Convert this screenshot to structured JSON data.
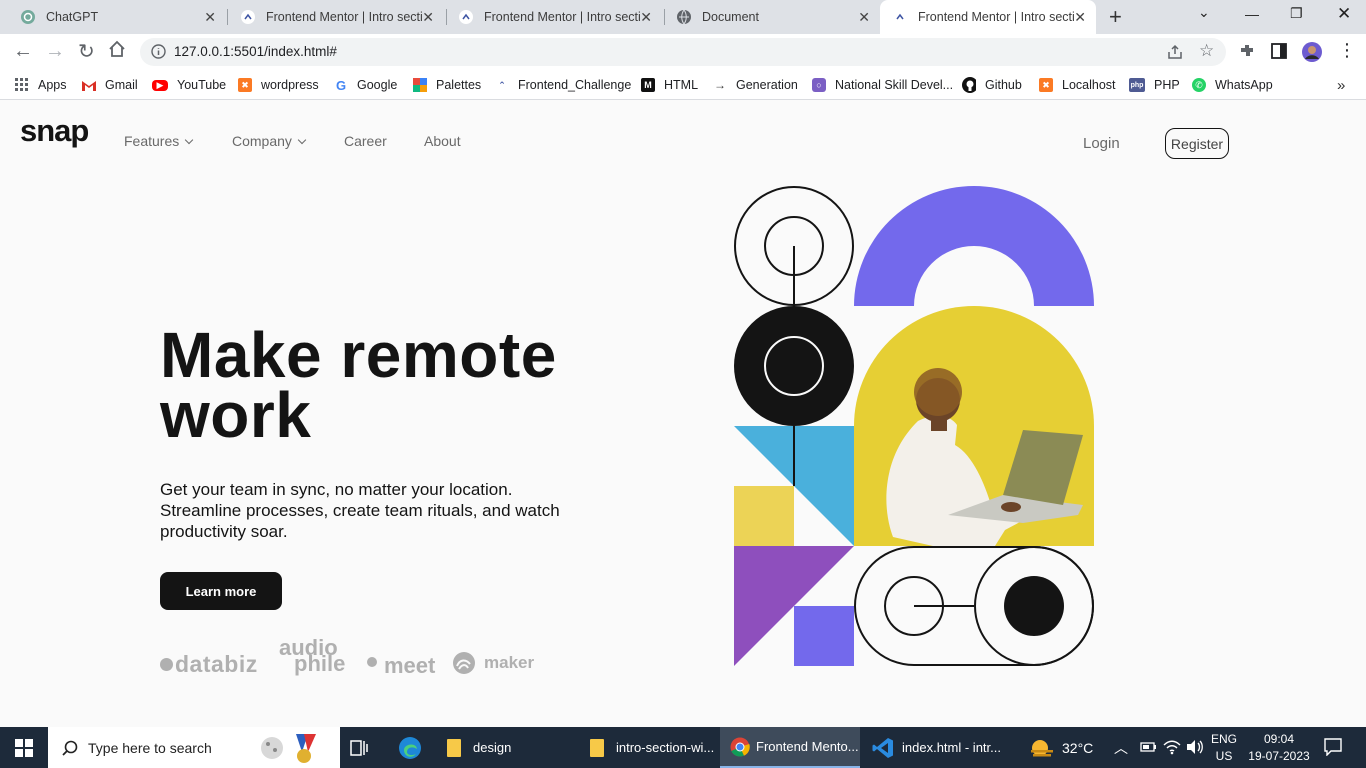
{
  "browser": {
    "tabs": [
      {
        "title": "ChatGPT"
      },
      {
        "title": "Frontend Mentor | Intro secti"
      },
      {
        "title": "Frontend Mentor | Intro secti"
      },
      {
        "title": "Document"
      },
      {
        "title": "Frontend Mentor | Intro secti"
      }
    ],
    "url": "127.0.0.1:5501/index.html#",
    "bookmarks": [
      {
        "label": "Apps"
      },
      {
        "label": "Gmail"
      },
      {
        "label": "YouTube"
      },
      {
        "label": "wordpress"
      },
      {
        "label": "Google"
      },
      {
        "label": "Palettes"
      },
      {
        "label": "Frontend_Challenge"
      },
      {
        "label": "HTML"
      },
      {
        "label": "Generation"
      },
      {
        "label": "National Skill Devel..."
      },
      {
        "label": "Github"
      },
      {
        "label": "Localhost"
      },
      {
        "label": "PHP"
      },
      {
        "label": "WhatsApp"
      }
    ]
  },
  "site": {
    "logo": "snap",
    "nav": [
      {
        "label": "Features"
      },
      {
        "label": "Company"
      },
      {
        "label": "Career"
      },
      {
        "label": "About"
      }
    ],
    "login": "Login",
    "register": "Register",
    "headline_line1": "Make remote",
    "headline_line2": "work",
    "subtext": "Get your team in sync, no matter your location. Streamline processes, create team rituals, and watch productivity soar.",
    "cta": "Learn more",
    "clients": {
      "databiz": "databiz",
      "audiophile_a": "audio",
      "audiophile_b": "phile",
      "meet": "meet",
      "maker": "maker"
    }
  },
  "taskbar": {
    "search_placeholder": "Type here to search",
    "apps": [
      {
        "label": "design"
      },
      {
        "label": "intro-section-wi..."
      },
      {
        "label": "Frontend Mento..."
      },
      {
        "label": "index.html - intr..."
      }
    ],
    "weather": "32°C",
    "lang1": "ENG",
    "lang2": "US",
    "time": "09:04",
    "date": "19-07-2023"
  },
  "colors": {
    "purple": "#7369ec",
    "blue": "#4ab0dc",
    "yellow": "#ecd356",
    "violet": "#8e4fbd",
    "dark": "#141414",
    "photo_bg": "#e6cf34"
  }
}
